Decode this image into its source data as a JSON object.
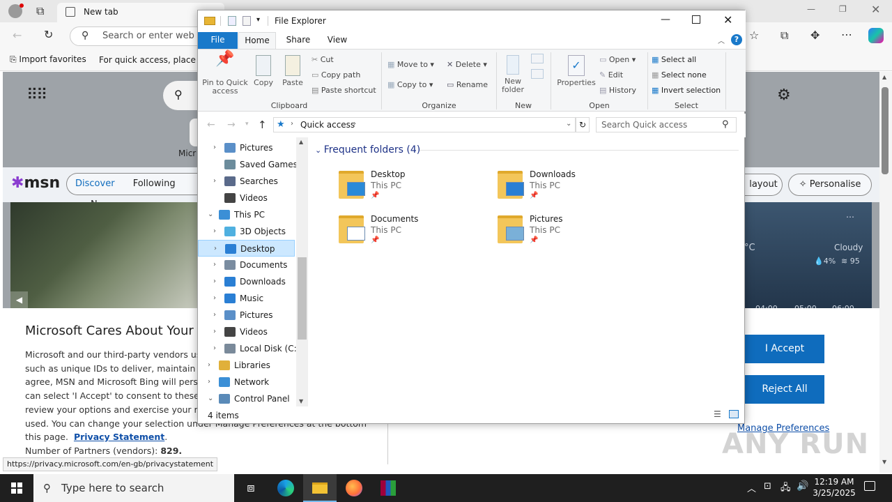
{
  "browser": {
    "tab_title": "New tab",
    "omnibox_placeholder": "Search or enter web a",
    "import_favorites": "Import favorites",
    "quick_access_hint": "For quick access, place yo",
    "msn": {
      "logo_text": "msn",
      "discover": "Discover",
      "following": "Following",
      "partial_m": "N",
      "partial_micro": "Micr",
      "layout": "layout",
      "personalise": "Personalise",
      "weather_condition": "Cloudy",
      "weather_precip": "4%",
      "weather_other": "95",
      "weather_unit": "°C",
      "weather_hours": [
        "04:00",
        "05:00",
        "06:00"
      ]
    },
    "consent": {
      "title": "Microsoft Cares About Your P",
      "lines": [
        "Microsoft and our third-party vendors use",
        "such as unique IDs to deliver, maintain anc",
        "agree, MSN and Microsoft Bing will persor",
        "can select 'I Accept' to consent to these us",
        "review your options and exercise your righ",
        "used.  You can change your selection under  Manage Preferences  at the bottom of"
      ],
      "this_page": "this page.",
      "privacy_link": "Privacy Statement",
      "partners_label": "Number of Partners (vendors):",
      "partners_count": "829.",
      "accept": "I Accept",
      "reject": "Reject All",
      "manage": "Manage Preferences"
    },
    "status_url": "https://privacy.microsoft.com/en-gb/privacystatement"
  },
  "explorer": {
    "title": "File Explorer",
    "tabs": [
      "File",
      "Home",
      "Share",
      "View"
    ],
    "ribbon": {
      "clipboard": {
        "pin": "Pin to Quick access",
        "copy": "Copy",
        "paste": "Paste",
        "cut": "Cut",
        "copy_path": "Copy path",
        "paste_shortcut": "Paste shortcut",
        "label": "Clipboard"
      },
      "organize": {
        "move_to": "Move to",
        "copy_to": "Copy to",
        "delete": "Delete",
        "rename": "Rename",
        "label": "Organize"
      },
      "new": {
        "new_folder": "New folder",
        "label": "New"
      },
      "open": {
        "properties": "Properties",
        "open": "Open",
        "edit": "Edit",
        "history": "History",
        "label": "Open"
      },
      "select": {
        "select_all": "Select all",
        "select_none": "Select none",
        "invert": "Invert selection",
        "label": "Select"
      }
    },
    "path": "Quick access",
    "search_placeholder": "Search Quick access",
    "tree": [
      {
        "label": "Pictures",
        "indent": 2,
        "arrow": "›",
        "icon": "pictures"
      },
      {
        "label": "Saved Games",
        "indent": 2,
        "arrow": "",
        "icon": "games"
      },
      {
        "label": "Searches",
        "indent": 2,
        "arrow": "›",
        "icon": "search"
      },
      {
        "label": "Videos",
        "indent": 2,
        "arrow": "",
        "icon": "videos"
      },
      {
        "label": "This PC",
        "indent": 1,
        "arrow": "⌄",
        "icon": "pc"
      },
      {
        "label": "3D Objects",
        "indent": 2,
        "arrow": "›",
        "icon": "3d"
      },
      {
        "label": "Desktop",
        "indent": 2,
        "arrow": "›",
        "icon": "desktop",
        "selected": true
      },
      {
        "label": "Documents",
        "indent": 2,
        "arrow": "›",
        "icon": "documents"
      },
      {
        "label": "Downloads",
        "indent": 2,
        "arrow": "›",
        "icon": "downloads"
      },
      {
        "label": "Music",
        "indent": 2,
        "arrow": "›",
        "icon": "music"
      },
      {
        "label": "Pictures",
        "indent": 2,
        "arrow": "›",
        "icon": "pictures"
      },
      {
        "label": "Videos",
        "indent": 2,
        "arrow": "›",
        "icon": "videos"
      },
      {
        "label": "Local Disk (C:)",
        "indent": 2,
        "arrow": "›",
        "icon": "disk"
      },
      {
        "label": "Libraries",
        "indent": 1,
        "arrow": "›",
        "icon": "libraries"
      },
      {
        "label": "Network",
        "indent": 1,
        "arrow": "›",
        "icon": "network"
      },
      {
        "label": "Control Panel",
        "indent": 1,
        "arrow": "⌄",
        "icon": "control"
      }
    ],
    "section_title": "Frequent folders (4)",
    "folders": [
      {
        "name": "Desktop",
        "location": "This PC",
        "icon": "desktop"
      },
      {
        "name": "Downloads",
        "location": "This PC",
        "icon": "downloads"
      },
      {
        "name": "Documents",
        "location": "This PC",
        "icon": "documents"
      },
      {
        "name": "Pictures",
        "location": "This PC",
        "icon": "pictures"
      }
    ],
    "status": "4 items"
  },
  "taskbar": {
    "search_placeholder": "Type here to search",
    "time": "12:19 AM",
    "date": "3/25/2025"
  },
  "watermark": "ANY RUN"
}
